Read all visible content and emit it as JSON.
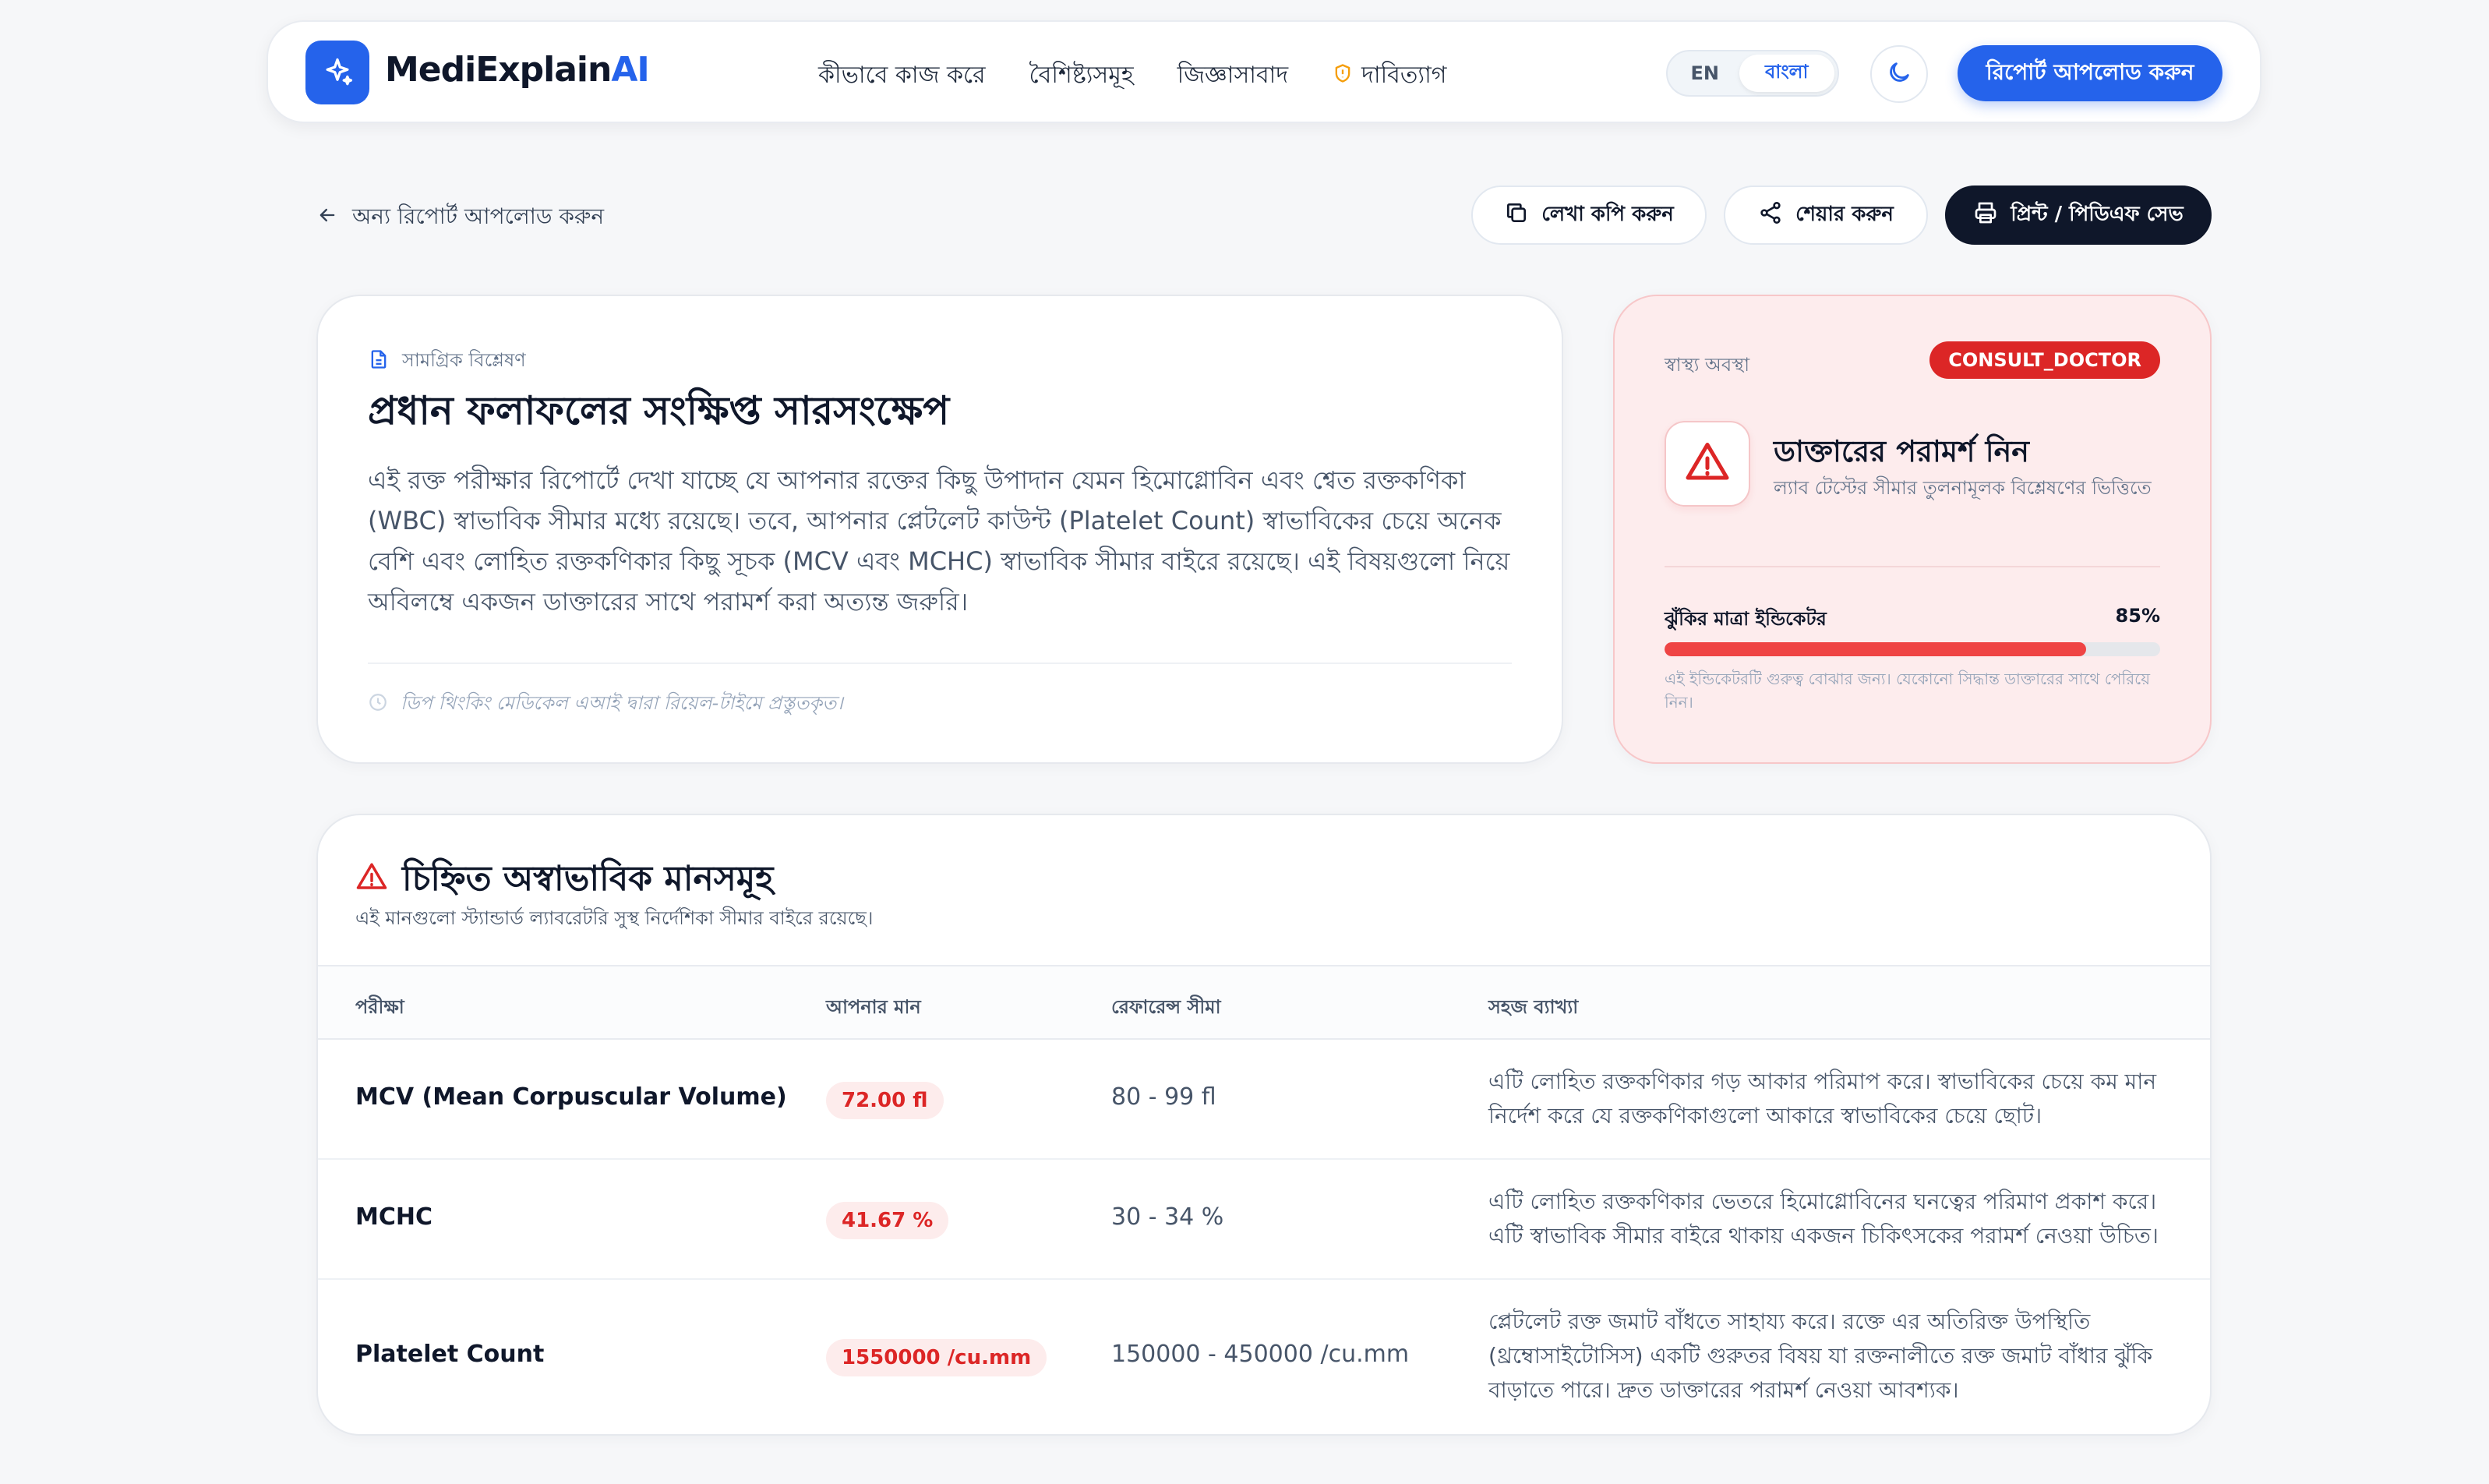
{
  "header": {
    "brand_main": "MediExplain",
    "brand_accent": "AI",
    "nav": [
      "কীভাবে কাজ করে",
      "বৈশিষ্ট্যসমূহ",
      "জিজ্ঞাসাবাদ",
      "দাবিত্যাগ"
    ],
    "lang_en": "EN",
    "lang_bn": "বাংলা",
    "upload_button": "রিপোর্ট আপলোড করুন"
  },
  "actions": {
    "back": "অন্য রিপোর্ট আপলোড করুন",
    "copy": "লেখা কপি করুন",
    "share": "শেয়ার করুন",
    "print": "প্রিন্ট / পিডিএফ সেভ"
  },
  "summary": {
    "label": "সামগ্রিক বিশ্লেষণ",
    "title": "প্রধান ফলাফলের সংক্ষিপ্ত সারসংক্ষেপ",
    "body": "এই রক্ত পরীক্ষার রিপোর্টে দেখা যাচ্ছে যে আপনার রক্তের কিছু উপাদান যেমন হিমোগ্লোবিন এবং শ্বেত রক্তকণিকা (WBC) স্বাভাবিক সীমার মধ্যে রয়েছে। তবে, আপনার প্লেটলেট কাউন্ট (Platelet Count) স্বাভাবিকের চেয়ে অনেক বেশি এবং লোহিত রক্তকণিকার কিছু সূচক (MCV এবং MCHC) স্বাভাবিক সীমার বাইরে রয়েছে। এই বিষয়গুলো নিয়ে অবিলম্বে একজন ডাক্তারের সাথে পরামর্শ করা অত্যন্ত জরুরি।",
    "footer": "ডিপ থিংকিং মেডিকেল এআই দ্বারা রিয়েল-টাইমে প্রস্তুতকৃত।"
  },
  "status": {
    "label": "স্বাস্থ্য অবস্থা",
    "badge": "CONSULT_DOCTOR",
    "title": "ডাক্তারের পরামর্শ নিন",
    "subtitle": "ল্যাব টেস্টের সীমার তুলনামূলক বিশ্লেষণের ভিত্তিতে",
    "risk_label": "ঝুঁকির মাত্রা ইন্ডিকেটর",
    "risk_percent_text": "85%",
    "risk_value": 85,
    "risk_note": "এই ইন্ডিকেটরটি গুরুত্ব বোঝার জন্য। যেকোনো সিদ্ধান্ত ডাক্তারের সাথে পেরিয়ে নিন।",
    "color": "#ef4444"
  },
  "abnormal": {
    "title": "চিহ্নিত অস্বাভাবিক মানসমূহ",
    "subtitle": "এই মানগুলো স্ট্যান্ডার্ড ল্যাবরেটরি সুস্থ নির্দেশিকা সীমার বাইরে রয়েছে।",
    "columns": [
      "পরীক্ষা",
      "আপনার মান",
      "রেফারেন্স সীমা",
      "সহজ ব্যাখ্যা"
    ],
    "rows": [
      {
        "test": "MCV (Mean Corpuscular Volume)",
        "value": "72.00 fl",
        "reference": "80 - 99 fl",
        "explanation": "এটি লোহিত রক্তকণিকার গড় আকার পরিমাপ করে। স্বাভাবিকের চেয়ে কম মান নির্দেশ করে যে রক্তকণিকাগুলো আকারে স্বাভাবিকের চেয়ে ছোট।"
      },
      {
        "test": "MCHC",
        "value": "41.67 %",
        "reference": "30 - 34 %",
        "explanation": "এটি লোহিত রক্তকণিকার ভেতরে হিমোগ্লোবিনের ঘনত্বের পরিমাণ প্রকাশ করে। এটি স্বাভাবিক সীমার বাইরে থাকায় একজন চিকিৎসকের পরামর্শ নেওয়া উচিত।"
      },
      {
        "test": "Platelet Count",
        "value": "1550000 /cu.mm",
        "reference": "150000 - 450000 /cu.mm",
        "explanation": "প্লেটলেট রক্ত জমাট বাঁধতে সাহায্য করে। রক্তে এর অতিরিক্ত উপস্থিতি (থ্রম্বোসাইটোসিস) একটি গুরুতর বিষয় যা রক্তনালীতে রক্ত জমাট বাঁধার ঝুঁকি বাড়াতে পারে। দ্রুত ডাক্তারের পরামর্শ নেওয়া আবশ্যক।"
      }
    ]
  },
  "colors": {
    "primary": "#2563eb",
    "danger": "#dc2626",
    "dark": "#0f172a"
  }
}
